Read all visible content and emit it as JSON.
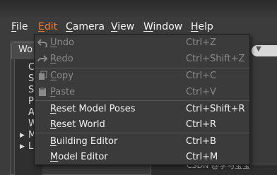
{
  "menubar": {
    "items": [
      {
        "label": "File",
        "mnemonic": "F",
        "rest": "ile"
      },
      {
        "label": "Edit",
        "mnemonic": "E",
        "rest": "dit"
      },
      {
        "label": "Camera",
        "mnemonic": "C",
        "rest": "amera"
      },
      {
        "label": "View",
        "mnemonic": "V",
        "rest": "iew"
      },
      {
        "label": "Window",
        "mnemonic": "W",
        "rest": "indow"
      },
      {
        "label": "Help",
        "mnemonic": "H",
        "rest": "elp"
      }
    ],
    "active": "Edit",
    "active_color": "#ef7a2e"
  },
  "dock": {
    "tab_label": "Wo",
    "tree_rows": [
      "C",
      "S",
      "S",
      "P",
      "A",
      "W",
      "M",
      "L"
    ],
    "expandable_rows": [
      "M",
      "L"
    ]
  },
  "edit_menu": {
    "items": [
      {
        "label": "Undo",
        "mnemonic": "U",
        "rest": "ndo",
        "shortcut": "Ctrl+Z",
        "enabled": false,
        "icon": "undo-arrow-icon"
      },
      {
        "label": "Redo",
        "mnemonic": "R",
        "rest": "edo",
        "shortcut": "Ctrl+Shift+Z",
        "enabled": false,
        "icon": "redo-arrow-icon"
      },
      {
        "label": "Copy",
        "mnemonic": "C",
        "rest": "opy",
        "shortcut": "Ctrl+C",
        "enabled": false,
        "icon": "copy-icon"
      },
      {
        "label": "Paste",
        "mnemonic": "P",
        "rest": "aste",
        "shortcut": "Ctrl+V",
        "enabled": false,
        "icon": "paste-icon"
      },
      {
        "label": "Reset Model Poses",
        "mnemonic": "R",
        "rest": "eset Model Poses",
        "shortcut": "Ctrl+Shift+R",
        "enabled": true
      },
      {
        "label": "Reset World",
        "mnemonic": "R",
        "rest": "eset World",
        "shortcut": "Ctrl+R",
        "enabled": true
      },
      {
        "label": "Building Editor",
        "mnemonic": "B",
        "rest": "uilding Editor",
        "shortcut": "Ctrl+B",
        "enabled": true
      },
      {
        "label": "Model Editor",
        "mnemonic": "M",
        "rest": "odel Editor",
        "shortcut": "Ctrl+M",
        "enabled": true
      }
    ]
  },
  "watermark": "CSDN @李马宝宝"
}
